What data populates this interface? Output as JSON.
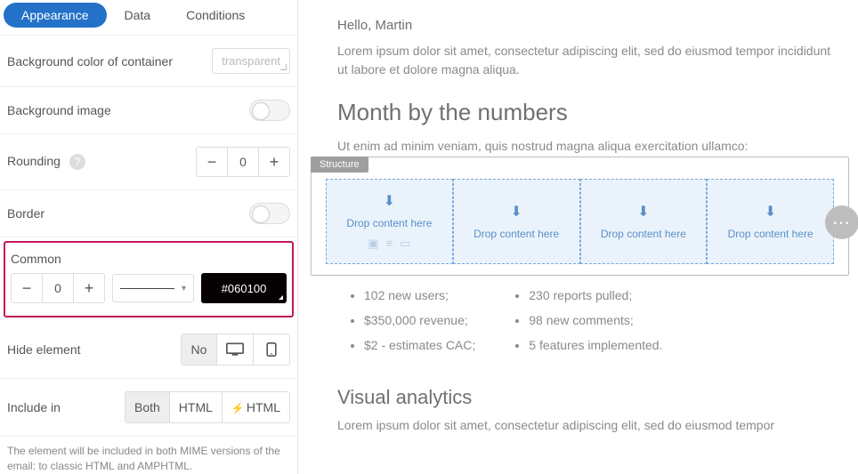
{
  "sidebar": {
    "tabs": {
      "appearance": "Appearance",
      "data": "Data",
      "conditions": "Conditions"
    },
    "bg_color_label": "Background color of container",
    "bg_color_value": "transparent",
    "bg_image_label": "Background image",
    "rounding_label": "Rounding",
    "rounding_value": "0",
    "border_label": "Border",
    "common_label": "Common",
    "common_value": "0",
    "common_color": "#060100",
    "hide_label": "Hide element",
    "hide_option_no": "No",
    "include_label": "Include in",
    "include": {
      "both": "Both",
      "html": "HTML",
      "amp": "HTML"
    },
    "include_note": "The element will be included in both MIME versions of the email: to classic HTML and AMPHTML."
  },
  "canvas": {
    "greeting": "Hello, Martin",
    "intro": "Lorem ipsum dolor sit amet, consectetur adipiscing elit, sed do eiusmod tempor incididunt ut labore et dolore magna aliqua.",
    "heading1": "Month by the numbers",
    "sub1": "Ut enim ad minim veniam, quis nostrud magna aliqua exercitation ullamco:",
    "structure_tag": "Structure",
    "drop_text": "Drop content here",
    "bullets_left": [
      "102 new users;",
      "$350,000 revenue;",
      "$2 - estimates CAC;"
    ],
    "bullets_right": [
      "230 reports pulled;",
      "98 new comments;",
      "5 features implemented."
    ],
    "heading2": "Visual analytics",
    "sub2": "Lorem ipsum dolor sit amet, consectetur adipiscing elit, sed do eiusmod tempor"
  }
}
